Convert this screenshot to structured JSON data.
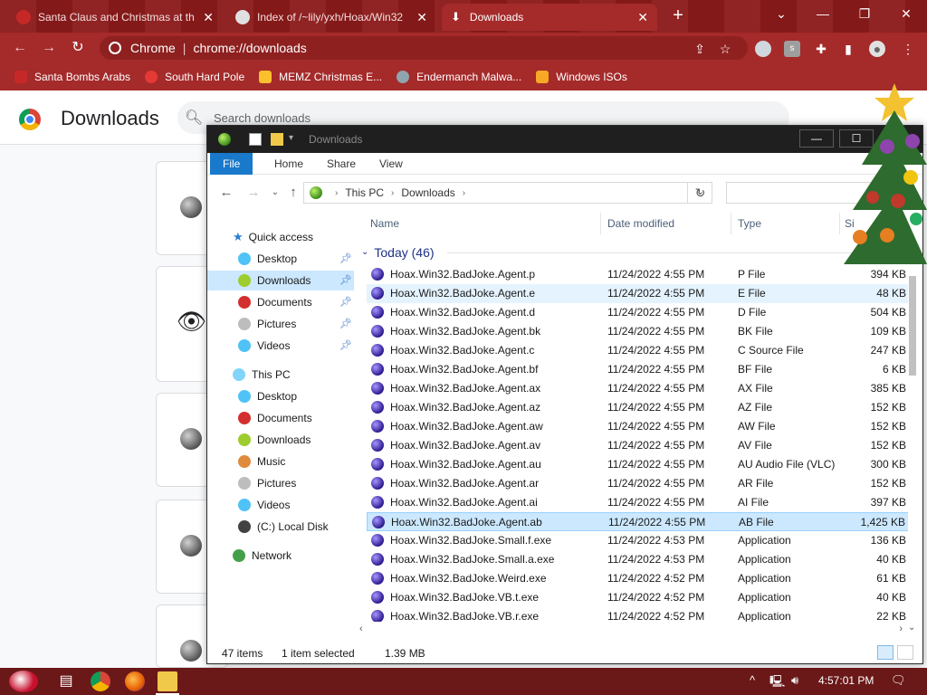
{
  "browser": {
    "tabs": [
      {
        "title": "Santa Claus and Christmas at th",
        "active": false
      },
      {
        "title": "Index of /~lily/yxh/Hoax/Win32",
        "active": false
      },
      {
        "title": "Downloads",
        "active": true
      }
    ],
    "omnibox": {
      "site": "Chrome",
      "url": "chrome://downloads"
    },
    "bookmarks": [
      {
        "label": "Santa Bombs Arabs",
        "color": "#c62828"
      },
      {
        "label": "South Hard Pole",
        "color": "#e53935"
      },
      {
        "label": "MEMZ Christmas E...",
        "color": "#fbc02d"
      },
      {
        "label": "Endermanch Malwa...",
        "color": "#90a4ae"
      },
      {
        "label": "Windows ISOs",
        "color": "#f9a825"
      }
    ]
  },
  "downloads_page": {
    "title": "Downloads",
    "search_placeholder": "Search downloads"
  },
  "explorer": {
    "title": "Downloads",
    "ribbon_tabs": [
      "File",
      "Home",
      "Share",
      "View"
    ],
    "breadcrumb": [
      "This PC",
      "Downloads"
    ],
    "nav": {
      "quick_access": "Quick access",
      "quick_items": [
        {
          "label": "Desktop",
          "color": "#4fc3f7"
        },
        {
          "label": "Downloads",
          "color": "#9ccc2e",
          "selected": true
        },
        {
          "label": "Documents",
          "color": "#d32f2f"
        },
        {
          "label": "Pictures",
          "color": "#bdbdbd"
        },
        {
          "label": "Videos",
          "color": "#4fc3f7"
        }
      ],
      "this_pc": "This PC",
      "pc_items": [
        {
          "label": "Desktop",
          "color": "#4fc3f7"
        },
        {
          "label": "Documents",
          "color": "#d32f2f"
        },
        {
          "label": "Downloads",
          "color": "#9ccc2e"
        },
        {
          "label": "Music",
          "color": "#e08a3c"
        },
        {
          "label": "Pictures",
          "color": "#bdbdbd"
        },
        {
          "label": "Videos",
          "color": "#4fc3f7"
        },
        {
          "label": "(C:) Local Disk",
          "color": "#424242"
        }
      ],
      "network": "Network"
    },
    "columns": [
      "Name",
      "Date modified",
      "Type",
      "Si"
    ],
    "group": "Today (46)",
    "files": [
      {
        "name": "Hoax.Win32.BadJoke.Agent.p",
        "date": "11/24/2022 4:55 PM",
        "type": "P File",
        "size": "394 KB"
      },
      {
        "name": "Hoax.Win32.BadJoke.Agent.e",
        "date": "11/24/2022 4:55 PM",
        "type": "E File",
        "size": "48 KB",
        "hover": true
      },
      {
        "name": "Hoax.Win32.BadJoke.Agent.d",
        "date": "11/24/2022 4:55 PM",
        "type": "D File",
        "size": "504 KB"
      },
      {
        "name": "Hoax.Win32.BadJoke.Agent.bk",
        "date": "11/24/2022 4:55 PM",
        "type": "BK File",
        "size": "109 KB"
      },
      {
        "name": "Hoax.Win32.BadJoke.Agent.c",
        "date": "11/24/2022 4:55 PM",
        "type": "C Source File",
        "size": "247 KB"
      },
      {
        "name": "Hoax.Win32.BadJoke.Agent.bf",
        "date": "11/24/2022 4:55 PM",
        "type": "BF File",
        "size": "6 KB"
      },
      {
        "name": "Hoax.Win32.BadJoke.Agent.ax",
        "date": "11/24/2022 4:55 PM",
        "type": "AX File",
        "size": "385 KB"
      },
      {
        "name": "Hoax.Win32.BadJoke.Agent.az",
        "date": "11/24/2022 4:55 PM",
        "type": "AZ File",
        "size": "152 KB"
      },
      {
        "name": "Hoax.Win32.BadJoke.Agent.aw",
        "date": "11/24/2022 4:55 PM",
        "type": "AW File",
        "size": "152 KB"
      },
      {
        "name": "Hoax.Win32.BadJoke.Agent.av",
        "date": "11/24/2022 4:55 PM",
        "type": "AV File",
        "size": "152 KB"
      },
      {
        "name": "Hoax.Win32.BadJoke.Agent.au",
        "date": "11/24/2022 4:55 PM",
        "type": "AU Audio File (VLC)",
        "size": "300 KB"
      },
      {
        "name": "Hoax.Win32.BadJoke.Agent.ar",
        "date": "11/24/2022 4:55 PM",
        "type": "AR File",
        "size": "152 KB"
      },
      {
        "name": "Hoax.Win32.BadJoke.Agent.ai",
        "date": "11/24/2022 4:55 PM",
        "type": "AI File",
        "size": "397 KB"
      },
      {
        "name": "Hoax.Win32.BadJoke.Agent.ab",
        "date": "11/24/2022 4:55 PM",
        "type": "AB File",
        "size": "1,425 KB",
        "selected": true
      },
      {
        "name": "Hoax.Win32.BadJoke.Small.f.exe",
        "date": "11/24/2022 4:53 PM",
        "type": "Application",
        "size": "136 KB"
      },
      {
        "name": "Hoax.Win32.BadJoke.Small.a.exe",
        "date": "11/24/2022 4:53 PM",
        "type": "Application",
        "size": "40 KB"
      },
      {
        "name": "Hoax.Win32.BadJoke.Weird.exe",
        "date": "11/24/2022 4:52 PM",
        "type": "Application",
        "size": "61 KB"
      },
      {
        "name": "Hoax.Win32.BadJoke.VB.t.exe",
        "date": "11/24/2022 4:52 PM",
        "type": "Application",
        "size": "40 KB"
      },
      {
        "name": "Hoax.Win32.BadJoke.VB.r.exe",
        "date": "11/24/2022 4:52 PM",
        "type": "Application",
        "size": "22 KB"
      }
    ],
    "status": {
      "count": "47 items",
      "selection": "1 item selected",
      "size": "1.39 MB"
    }
  },
  "taskbar": {
    "clock": "4:57:01 PM"
  }
}
